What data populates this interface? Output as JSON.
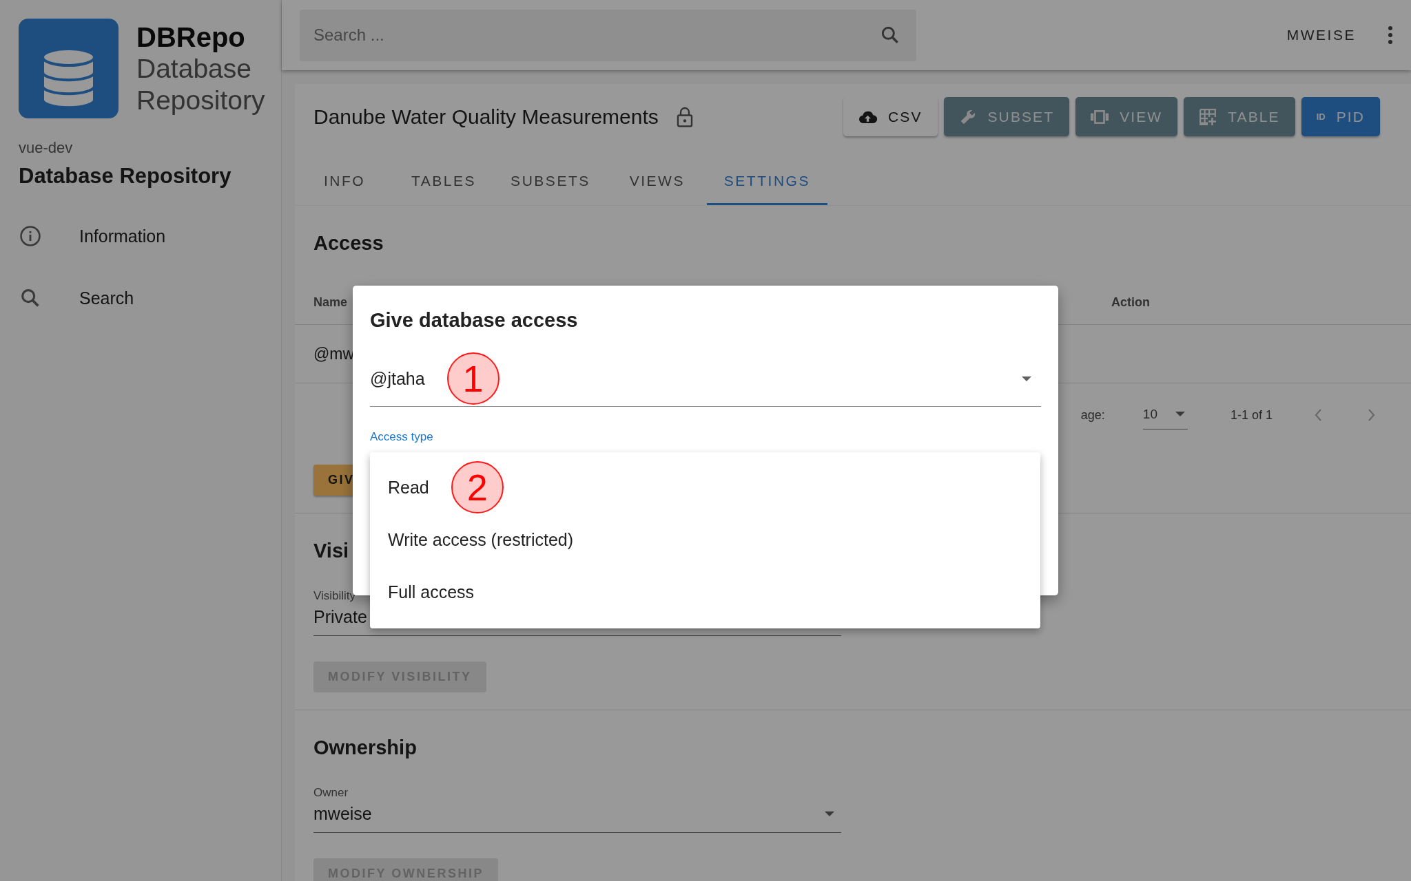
{
  "sidebar": {
    "brand": "DBRepo",
    "brand_lines": [
      "Database",
      "Repository"
    ],
    "instance": "vue-dev",
    "heading": "Database Repository",
    "items": [
      {
        "label": "Information",
        "kind": "info"
      },
      {
        "label": "Search",
        "kind": "search"
      }
    ]
  },
  "topbar": {
    "search_placeholder": "Search ...",
    "user": "MWEISE"
  },
  "database": {
    "title": "Danube Water Quality Measurements",
    "locked": true,
    "actions": [
      {
        "label": "CSV",
        "kind": "csv"
      },
      {
        "label": "SUBSET",
        "kind": "subset"
      },
      {
        "label": "VIEW",
        "kind": "view"
      },
      {
        "label": "TABLE",
        "kind": "table"
      },
      {
        "label": "PID",
        "kind": "pid",
        "badge": "ID"
      }
    ],
    "tabs": [
      {
        "label": "INFO",
        "selected": false
      },
      {
        "label": "TABLES",
        "selected": false
      },
      {
        "label": "SUBSETS",
        "selected": false
      },
      {
        "label": "VIEWS",
        "selected": false
      },
      {
        "label": "SETTINGS",
        "selected": true
      }
    ]
  },
  "access": {
    "heading": "Access",
    "columns": [
      "Name",
      "Action"
    ],
    "rows": [
      {
        "name": "@mw"
      }
    ],
    "pagination": {
      "rows_per_page_label": "age:",
      "rows_per_page": "10",
      "range": "1-1 of 1"
    },
    "give_button": {
      "label": "GIV",
      "disabled": false
    }
  },
  "visibility": {
    "heading": "Visi",
    "label": "Visibility",
    "value": "Private",
    "button": {
      "label": "MODIFY VISIBILITY",
      "disabled": true
    }
  },
  "ownership": {
    "heading": "Ownership",
    "label": "Owner",
    "value": "mweise",
    "button": {
      "label": "MODIFY OWNERSHIP",
      "disabled": true
    }
  },
  "dialog": {
    "title": "Give database access",
    "user_value": "@jtaha",
    "user_annotation": "1",
    "access_type_label": "Access type",
    "options": [
      {
        "label": "Read",
        "annotation": "2"
      },
      {
        "label": "Write access (restricted)"
      },
      {
        "label": "Full access"
      }
    ]
  }
}
